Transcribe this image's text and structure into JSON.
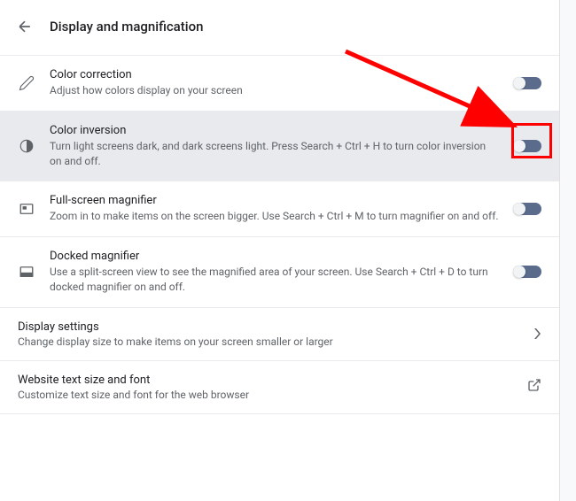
{
  "header": {
    "title": "Display and magnification"
  },
  "settings": [
    {
      "id": "color-correction",
      "title": "Color correction",
      "desc": "Adjust how colors display on your screen",
      "icon": "pencil"
    },
    {
      "id": "color-inversion",
      "title": "Color inversion",
      "desc": "Turn light screens dark, and dark screens light. Press Search + Ctrl + H to turn color inversion on and off.",
      "icon": "contrast"
    },
    {
      "id": "fullscreen-magnifier",
      "title": "Full-screen magnifier",
      "desc": "Zoom in to make items on the screen bigger. Use Search + Ctrl + M to turn magnifier on and off.",
      "icon": "fullscreen"
    },
    {
      "id": "docked-magnifier",
      "title": "Docked magnifier",
      "desc": "Use a split-screen view to see the magnified area of your screen. Use Search + Ctrl + D to turn docked magnifier on and off.",
      "icon": "docked"
    }
  ],
  "links": [
    {
      "id": "display-settings",
      "title": "Display settings",
      "desc": "Change display size to make items on your screen smaller or larger",
      "icon": "chevron"
    },
    {
      "id": "website-text",
      "title": "Website text size and font",
      "desc": "Customize text size and font for the web browser",
      "icon": "external"
    }
  ]
}
